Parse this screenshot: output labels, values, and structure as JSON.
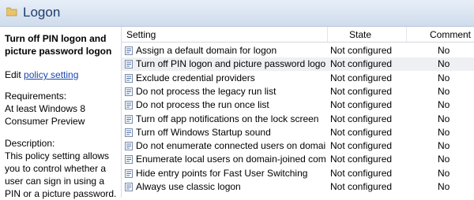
{
  "window": {
    "title": "Logon",
    "icon": "folder-icon"
  },
  "left_panel": {
    "policy_title": "Turn off PIN logon and picture password logon",
    "edit_prefix": "Edit ",
    "edit_link": "policy setting",
    "requirements_label": "Requirements:",
    "requirements_text": "At least Windows 8 Consumer Preview",
    "description_label": "Description:",
    "description_text": "This policy setting allows you to control whether a user can sign in using a PIN or a picture password."
  },
  "grid": {
    "columns": [
      "Setting",
      "State",
      "Comment"
    ],
    "rows": [
      {
        "setting": "Assign a default domain for logon",
        "state": "Not configured",
        "comment": "No"
      },
      {
        "setting": "Turn off PIN logon and picture password logon",
        "state": "Not configured",
        "comment": "No"
      },
      {
        "setting": "Exclude credential providers",
        "state": "Not configured",
        "comment": "No"
      },
      {
        "setting": "Do not process the legacy run list",
        "state": "Not configured",
        "comment": "No"
      },
      {
        "setting": "Do not process the run once list",
        "state": "Not configured",
        "comment": "No"
      },
      {
        "setting": "Turn off app notifications on the lock screen",
        "state": "Not configured",
        "comment": "No"
      },
      {
        "setting": "Turn off Windows Startup sound",
        "state": "Not configured",
        "comment": "No"
      },
      {
        "setting": "Do not enumerate connected users on domain-j...",
        "state": "Not configured",
        "comment": "No"
      },
      {
        "setting": "Enumerate local users on domain-joined compu...",
        "state": "Not configured",
        "comment": "No"
      },
      {
        "setting": "Hide entry points for Fast User Switching",
        "state": "Not configured",
        "comment": "No"
      },
      {
        "setting": "Always use classic logon",
        "state": "Not configured",
        "comment": "No"
      }
    ],
    "selected_row": 1,
    "row_icon": "policy-setting-icon"
  },
  "colors": {
    "title_text": "#1e3d6b",
    "link": "#1a47b0",
    "selected_row": "#eef0f3"
  }
}
